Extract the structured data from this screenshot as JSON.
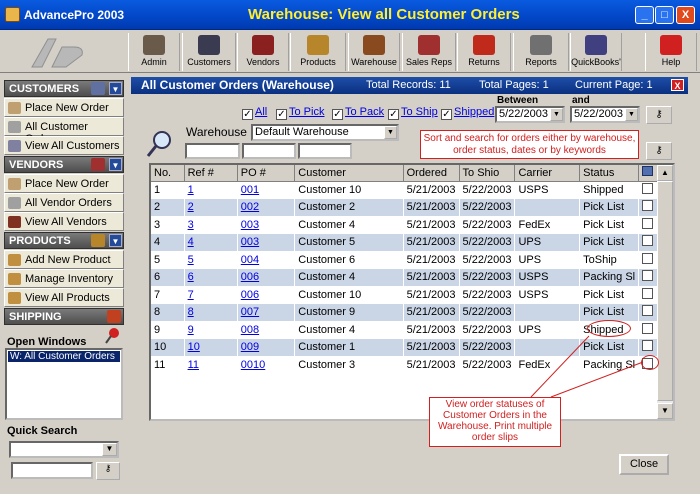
{
  "app": {
    "title": "AdvancePro 2003",
    "window_title": "Warehouse: View all Customer Orders",
    "controls": [
      "_",
      "□",
      "X"
    ]
  },
  "toolbar": [
    {
      "label": "Admin",
      "icon": "admin-icon",
      "color": "#6a5a4a"
    },
    {
      "label": "Customers",
      "icon": "customers-icon",
      "color": "#3a3a50"
    },
    {
      "label": "Vendors",
      "icon": "vendors-icon",
      "color": "#8a2020"
    },
    {
      "label": "Products",
      "icon": "products-icon",
      "color": "#b8862a"
    },
    {
      "label": "Warehouse",
      "icon": "warehouse-icon",
      "color": "#8a4a20"
    },
    {
      "label": "Sales Reps",
      "icon": "sales-reps-icon",
      "color": "#a03030"
    },
    {
      "label": "Returns",
      "icon": "returns-icon",
      "color": "#c02a1a"
    },
    {
      "label": "Reports",
      "icon": "reports-icon",
      "color": "#707070"
    },
    {
      "label": "QuickBooks'",
      "icon": "quickbooks-icon",
      "color": "#404080"
    },
    {
      "label": "Help",
      "icon": "help-icon",
      "color": "#d02020"
    }
  ],
  "sidebar": {
    "customers_header": "CUSTOMERS",
    "customers": [
      "Place New Order",
      "All Customer Orders",
      "View All Customers"
    ],
    "vendors_header": "VENDORS",
    "vendors": [
      "Place New Order",
      "All Vendor Orders",
      "View All Vendors"
    ],
    "products_header": "PRODUCTS",
    "products": [
      "Add New Product",
      "Manage Inventory",
      "View All Products"
    ],
    "shipping_header": "SHIPPING",
    "open_windows_label": "Open Windows",
    "open_window_item": "W: All Customer Orders",
    "quick_search_label": "Quick Search"
  },
  "main": {
    "title": "All Customer Orders (Warehouse)",
    "total_records": "Total Records: 11",
    "total_pages": "Total Pages: 1",
    "current_page": "Current Page:  1",
    "filters": {
      "all": "All",
      "to_pick": "To Pick",
      "to_pack": "To Pack",
      "to_ship": "To Ship",
      "shipped": "Shipped"
    },
    "between_label": "Between",
    "and_label": "and",
    "date_from": "5/22/2003",
    "date_to": "5/22/2003",
    "warehouse_label": "Warehouse",
    "warehouse_value": "Default Warehouse",
    "tip": "Sort and search for orders either by warehouse, order status, dates or by keywords",
    "callout": "View order statuses of Customer Orders in the Warehouse. Print multiple order slips",
    "close_label": "Close"
  },
  "table": {
    "columns": [
      "No.",
      "Ref #",
      "PO #",
      "Customer",
      "Ordered",
      "To Shio",
      "Carrier",
      "Status"
    ],
    "rows": [
      [
        "1",
        "1",
        "001",
        "Customer 10",
        "5/21/2003",
        "5/22/2003",
        "USPS",
        "Shipped"
      ],
      [
        "2",
        "2",
        "002",
        "Customer 2",
        "5/21/2003",
        "5/22/2003",
        "",
        "Pick List"
      ],
      [
        "3",
        "3",
        "003",
        "Customer 4",
        "5/21/2003",
        "5/22/2003",
        "FedEx",
        "Pick List"
      ],
      [
        "4",
        "4",
        "003",
        "Customer 5",
        "5/21/2003",
        "5/22/2003",
        "UPS",
        "Pick List"
      ],
      [
        "5",
        "5",
        "004",
        "Customer 6",
        "5/21/2003",
        "5/22/2003",
        "UPS",
        "ToShip"
      ],
      [
        "6",
        "6",
        "006",
        "Customer 4",
        "5/21/2003",
        "5/22/2003",
        "USPS",
        "Packing Sl"
      ],
      [
        "7",
        "7",
        "006",
        "Customer 10",
        "5/21/2003",
        "5/22/2003",
        "USPS",
        "Pick List"
      ],
      [
        "8",
        "8",
        "007",
        "Customer 9",
        "5/21/2003",
        "5/22/2003",
        "",
        "Pick List"
      ],
      [
        "9",
        "9",
        "008",
        "Customer 4",
        "5/21/2003",
        "5/22/2003",
        "UPS",
        "Shipped"
      ],
      [
        "10",
        "10",
        "009",
        "Customer 1",
        "5/21/2003",
        "5/22/2003",
        "",
        "Pick List"
      ],
      [
        "11",
        "11",
        "0010",
        "Customer 3",
        "5/21/2003",
        "5/22/2003",
        "FedEx",
        "Packing Sl"
      ]
    ]
  }
}
